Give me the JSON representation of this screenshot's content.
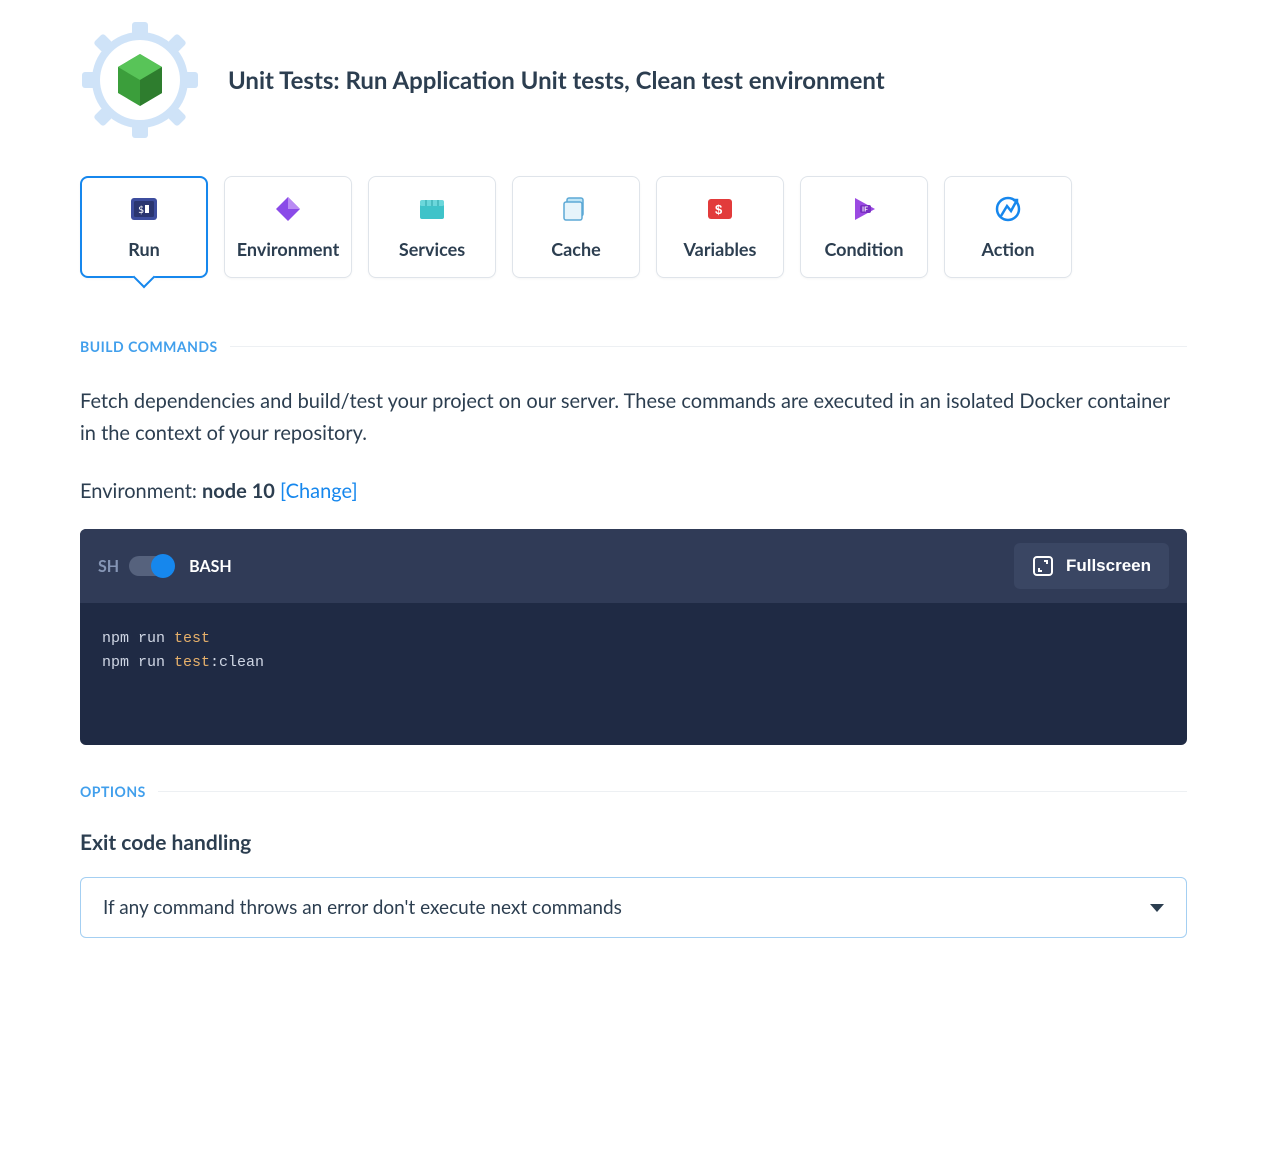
{
  "header": {
    "title": "Unit Tests: Run Application Unit tests, Clean test environment"
  },
  "tabs": [
    {
      "label": "Run",
      "active": true,
      "icon": "run-icon"
    },
    {
      "label": "Environment",
      "active": false,
      "icon": "environment-icon"
    },
    {
      "label": "Services",
      "active": false,
      "icon": "services-icon"
    },
    {
      "label": "Cache",
      "active": false,
      "icon": "cache-icon"
    },
    {
      "label": "Variables",
      "active": false,
      "icon": "variables-icon"
    },
    {
      "label": "Condition",
      "active": false,
      "icon": "condition-icon"
    },
    {
      "label": "Action",
      "active": false,
      "icon": "action-icon"
    }
  ],
  "build": {
    "section_label": "BUILD COMMANDS",
    "description": "Fetch dependencies and build/test your project on our server. These commands are executed in an isolated Docker container in the context of your repository.",
    "env_prefix": "Environment: ",
    "env_value": "node 10",
    "env_change": "[Change]"
  },
  "editor": {
    "sh_label": "SH",
    "bash_label": "BASH",
    "fullscreen_label": "Fullscreen",
    "code_lines": [
      {
        "pre": "npm run ",
        "kw": "test",
        "post": ""
      },
      {
        "pre": "npm run ",
        "kw": "test",
        "post": ":clean"
      }
    ]
  },
  "options": {
    "section_label": "OPTIONS",
    "title": "Exit code handling",
    "select_value": "If any command throws an error don't execute next commands"
  }
}
